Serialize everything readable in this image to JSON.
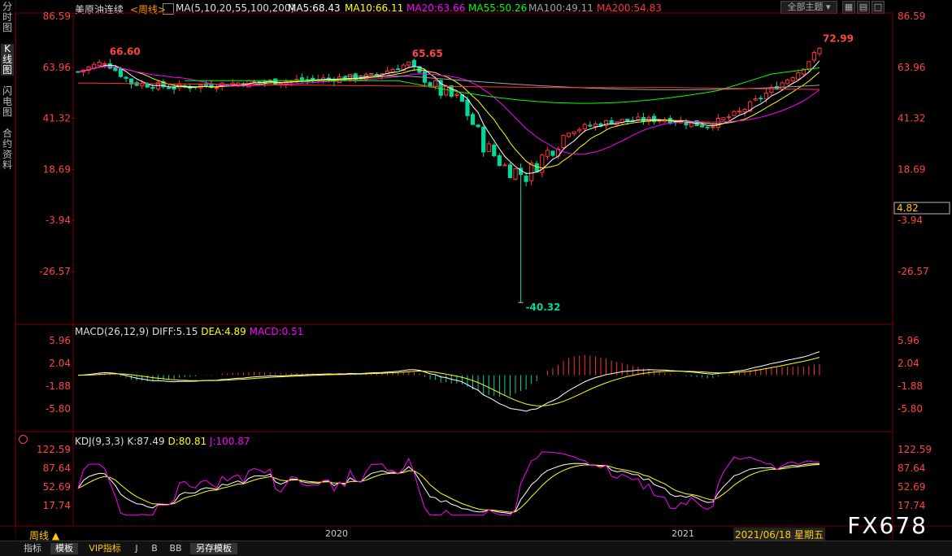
{
  "sidebar": {
    "tabs": [
      "分时图",
      "K线图",
      "闪电图",
      "合约资料"
    ]
  },
  "main_header": {
    "instrument": "美原油连续",
    "period": "<周线>",
    "ma_params": "MA(5,10,20,55,100,200)",
    "ma5": "MA5:68.43",
    "ma10": "MA10:66.11",
    "ma20": "MA20:63.66",
    "ma55": "MA55:50.26",
    "ma100": "MA100:49.11",
    "ma200": "MA200:54.83",
    "theme_select": "全部主题"
  },
  "macd_header": {
    "name": "MACD(26,12,9)",
    "diff": "DIFF:5.15",
    "dea": "DEA:4.89",
    "macd": "MACD:0.51"
  },
  "kdj_header": {
    "name": "KDJ(9,3,3)",
    "k": "K:87.49",
    "d": "D:80.81",
    "j": "J:100.87"
  },
  "price_axis": {
    "ticks": [
      "86.59",
      "63.96",
      "41.32",
      "18.69",
      "-3.94",
      "-26.57"
    ],
    "current_price": "4.82"
  },
  "macd_axis": {
    "ticks": [
      "5.96",
      "2.04",
      "-1.88",
      "-5.80"
    ]
  },
  "kdj_axis": {
    "ticks": [
      "122.59",
      "87.64",
      "52.69",
      "17.74"
    ]
  },
  "annotations": {
    "high_2019": "66.60",
    "high_2020": "65.65",
    "low_2020": "-40.32",
    "high_2021": "72.99"
  },
  "time_axis": {
    "period_label": "周线",
    "year_2020": "2020",
    "year_2021": "2021",
    "cursor_date": "2021/06/18 星期五"
  },
  "bottom_tabs": [
    "指标",
    "模板",
    "VIP指标",
    "J",
    "B",
    "BB",
    "另存模板"
  ],
  "watermark": "FX678",
  "colors": {
    "ma5": "#ffffff",
    "ma10": "#ffff00",
    "ma20": "#ff00ff",
    "ma55": "#00ff00",
    "ma100": "#a0a0a0",
    "ma200": "#ff3333",
    "up": "#ff3333",
    "down": "#00d89a",
    "axis_text": "#ff4444"
  },
  "chart_data": {
    "type": "candlestick",
    "series_name": "美原油连续",
    "period": "weekly",
    "y_range": [
      -40.32,
      86.59
    ],
    "key_points": [
      {
        "label": "66.60",
        "value": 66.6
      },
      {
        "label": "65.65",
        "value": 65.65
      },
      {
        "label": "-40.32",
        "value": -40.32
      },
      {
        "label": "72.99",
        "value": 72.99
      }
    ],
    "last_ma": {
      "MA5": 68.43,
      "MA10": 66.11,
      "MA20": 63.66,
      "MA55": 50.26,
      "MA100": 49.11,
      "MA200": 54.83
    },
    "macd_last": {
      "DIFF": 5.15,
      "DEA": 4.89,
      "MACD": 0.51
    },
    "kdj_last": {
      "K": 87.49,
      "D": 80.81,
      "J": 100.87
    }
  }
}
